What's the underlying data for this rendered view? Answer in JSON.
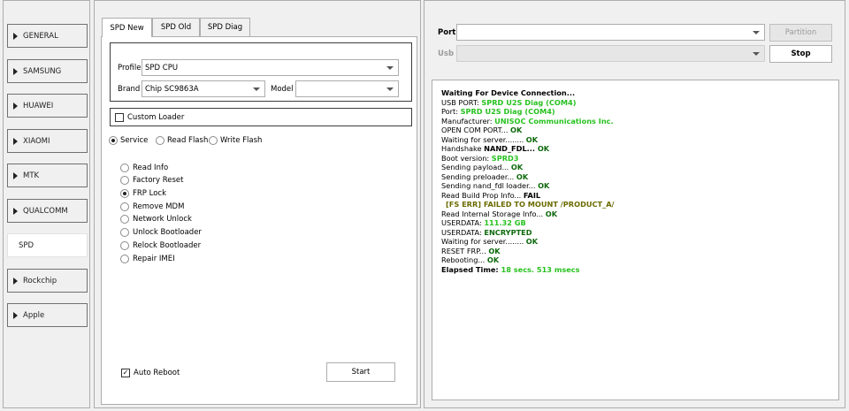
{
  "sidebar": {
    "items": [
      {
        "label": "GENERAL",
        "arrow": true
      },
      {
        "label": "SAMSUNG",
        "arrow": true
      },
      {
        "label": "HUAWEI",
        "arrow": true
      },
      {
        "label": "XIAOMI",
        "arrow": true
      },
      {
        "label": "MTK",
        "arrow": true
      },
      {
        "label": "QUALCOMM",
        "arrow": true
      },
      {
        "label": "SPD",
        "arrow": false,
        "active": true
      },
      {
        "label": "Rockchip",
        "arrow": true
      },
      {
        "label": "Apple",
        "arrow": true
      }
    ]
  },
  "tabs": [
    {
      "label": "SPD New",
      "active": true
    },
    {
      "label": "SPD Old"
    },
    {
      "label": "SPD Diag"
    }
  ],
  "form": {
    "profile_label": "Profile",
    "profile_value": "SPD CPU",
    "brand_label": "Brand",
    "brand_value": "Chip SC9863A",
    "model_label": "Model",
    "model_value": "",
    "custom_loader_label": "Custom Loader",
    "custom_loader_checked": false
  },
  "modes": {
    "service": "Service",
    "read_flash": "Read  Flash",
    "write_flash": "Write Flash",
    "selected": "Service"
  },
  "operations": {
    "items": [
      "Read Info",
      "Factory Reset",
      "FRP Lock",
      "Remove MDM",
      "Network Unlock",
      "Unlock Bootloader",
      "Relock Bootloader",
      "Repair IMEI"
    ],
    "selected": "FRP Lock"
  },
  "footer": {
    "auto_reboot_label": "Auto Reboot",
    "auto_reboot_checked": true,
    "start_label": "Start"
  },
  "connection": {
    "port_label": "Port",
    "port_value": "",
    "usb_label": "Usb",
    "usb_value": "",
    "partition_label": "Partition",
    "stop_label": "Stop"
  },
  "log": {
    "l1": "Waiting For Device Connection...",
    "l2a": "USB PORT: ",
    "l2b": "SPRD U2S Diag (COM4)",
    "l3a": "Port: ",
    "l3b": "SPRD U2S Diag (COM4)",
    "l4a": "Manufacturer: ",
    "l4b": "UNISOC Communications Inc.",
    "l5a": "OPEN COM PORT... ",
    "l5b": "OK",
    "l6a": "Waiting for server........ ",
    "l6b": "OK",
    "l7a": "Handshake ",
    "l7b": "NAND_FDL... ",
    "l7c": "OK",
    "l8a": "Boot version: ",
    "l8b": "SPRD3",
    "l9a": "Sending payload... ",
    "l9b": "OK",
    "l10a": "Sending preloader... ",
    "l10b": "OK",
    "l11a": "Sending nand_fdl loader... ",
    "l11b": "OK",
    "l12a": "Read Build Prop Info... ",
    "l12b": "FAIL",
    "l13": "[FS ERR] FAILED TO MOUNT /PRODUCT_A/",
    "l14a": "Read Internal Storage Info... ",
    "l14b": "OK",
    "l15a": "USERDATA: ",
    "l15b": "111.32 GB",
    "l16a": "USERDATA: ",
    "l16b": "ENCRYPTED",
    "l17a": "Waiting for server........ ",
    "l17b": "OK",
    "l18a": "RESET FRP... ",
    "l18b": "OK",
    "l19a": "Rebooting... ",
    "l19b": "OK",
    "l20a": "Elapsed Time: ",
    "l20b": "18 secs. 513 msecs"
  },
  "colors": {
    "log_ok_bright": "#27c21f",
    "log_ok_dark": "#0e6a0e",
    "log_warning": "#6b6b00"
  }
}
